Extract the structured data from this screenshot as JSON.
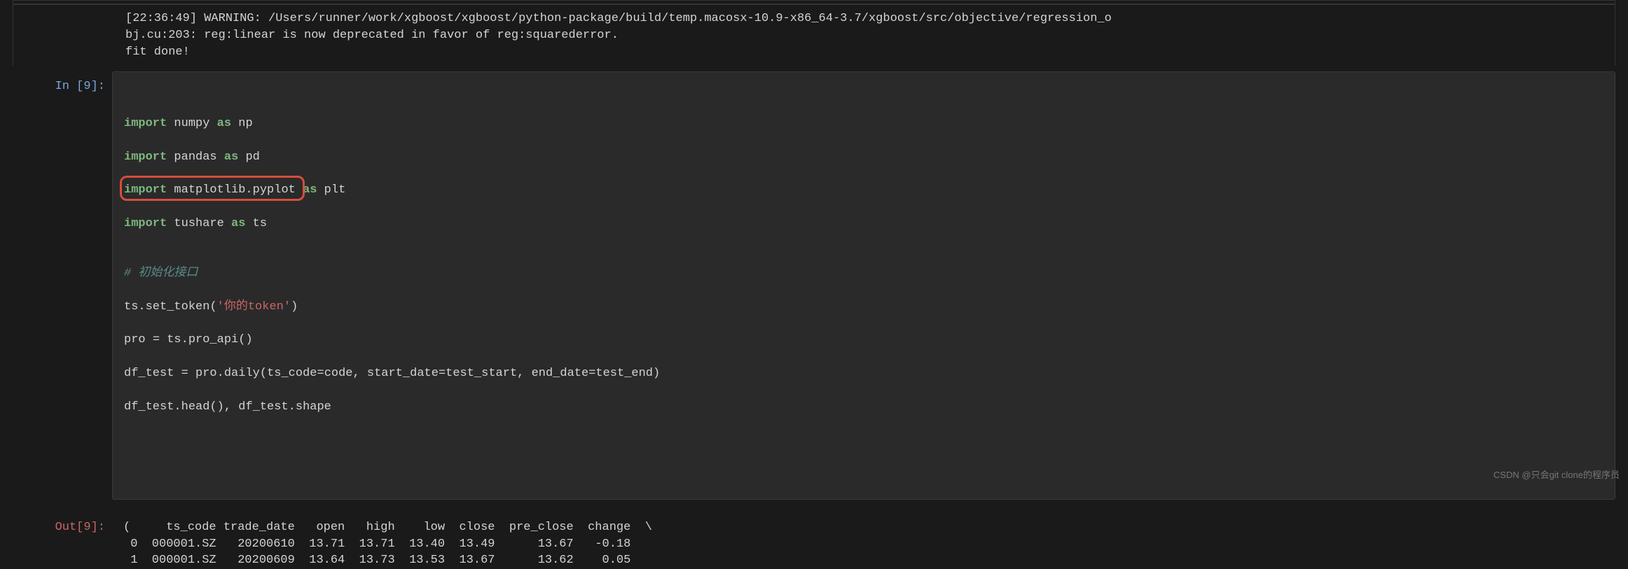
{
  "output_warning": {
    "line1": "[22:36:49] WARNING: /Users/runner/work/xgboost/xgboost/python-package/build/temp.macosx-10.9-x86_64-3.7/xgboost/src/objective/regression_o",
    "line2": "bj.cu:203: reg:linear is now deprecated in favor of reg:squarederror.",
    "line3": "fit done!"
  },
  "prompts": {
    "in": "In [9]:",
    "out": "Out[9]:"
  },
  "code": {
    "blank1": "",
    "import1": {
      "kw1": "import",
      "mod": " numpy ",
      "kw2": "as",
      "alias": " np"
    },
    "import2": {
      "kw1": "import",
      "mod": " pandas ",
      "kw2": "as",
      "alias": " pd"
    },
    "import3": {
      "kw1": "import",
      "mod": " matplotlib.pyplot ",
      "kw2": "as",
      "alias": " plt"
    },
    "import4": {
      "kw1": "import",
      "mod": " tushare ",
      "kw2": "as",
      "alias": " ts"
    },
    "blank2": "",
    "comment1": "# 初始化接口",
    "line_token": {
      "p1": "ts",
      "dot1": ".",
      "fn1": "set_token",
      "paren1": "(",
      "str1": "'你的token'",
      "paren2": ")"
    },
    "line_pro": {
      "p1": "pro ",
      "eq": "=",
      "p2": " ts",
      "dot": ".",
      "fn": "pro_api",
      "par": "()"
    },
    "line_daily": {
      "p1": "df_test ",
      "eq": "=",
      "p2": " pro",
      "dot": ".",
      "fn": "daily",
      "open": "(",
      "a1": "ts_code",
      "e1": "=",
      "v1": "code, ",
      "a2": "start_date",
      "e2": "=",
      "v2": "test_start, ",
      "a3": "end_date",
      "e3": "=",
      "v3": "test_end",
      "close": ")"
    },
    "line_head": {
      "p1": "df_test",
      "dot1": ".",
      "fn1": "head",
      "par1": "()",
      "comma": ", ",
      "p2": "df_test",
      "dot2": ".",
      "attr": "shape"
    }
  },
  "out_data": {
    "header": "(     ts_code trade_date   open   high    low  close  pre_close  change  \\",
    "row0": " 0  000001.SZ   20200610  13.71  13.71  13.40  13.49      13.67   -0.18   ",
    "row1": " 1  000001.SZ   20200609  13.64  13.73  13.53  13.67      13.62    0.05   "
  },
  "watermark": "CSDN @只会git clone的程序员"
}
